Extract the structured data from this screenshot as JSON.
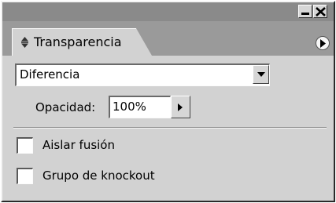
{
  "window": {
    "minimize_icon": "minimize-icon",
    "close_icon": "close-icon"
  },
  "panel": {
    "tab_label": "Transparencia",
    "tab_icon": "diamond-arrows-icon",
    "menu_icon": "panel-menu-arrow-icon"
  },
  "blend_mode": {
    "selected": "Diferencia"
  },
  "opacity": {
    "label": "Opacidad:",
    "value": "100%"
  },
  "options": [
    {
      "label": "Aislar fusión",
      "checked": false
    },
    {
      "label": "Grupo de knockout",
      "checked": false
    }
  ]
}
